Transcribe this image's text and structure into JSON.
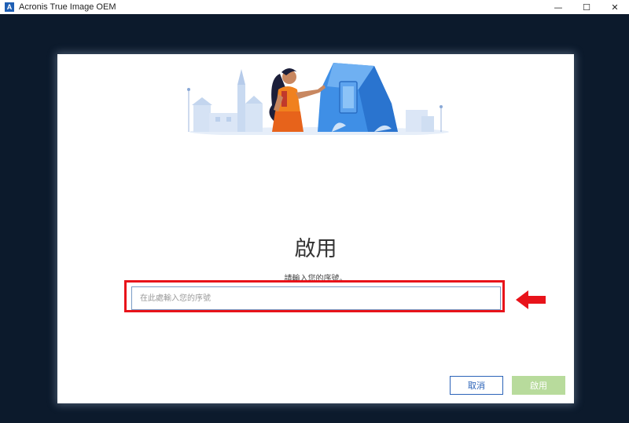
{
  "window": {
    "logo_letter": "A",
    "title": "Acronis True Image OEM",
    "controls": {
      "minimize": "—",
      "maximize": "☐",
      "close": "✕"
    }
  },
  "dialog": {
    "title": "啟用",
    "prompt": "請輸入您的序號。",
    "serial_input": {
      "placeholder": "在此處輸入您的序號",
      "value": ""
    },
    "buttons": {
      "cancel": "取消",
      "activate": "啟用"
    }
  },
  "colors": {
    "workspace_bg": "#0c1a2c",
    "accent_blue": "#2b63b8",
    "activate_disabled": "#b8db9c",
    "highlight_red": "#e8131a"
  },
  "icons": {
    "app_logo": "acronis-logo-icon",
    "annotation_arrow": "left-arrow-icon",
    "illustration": "activation-illustration"
  }
}
